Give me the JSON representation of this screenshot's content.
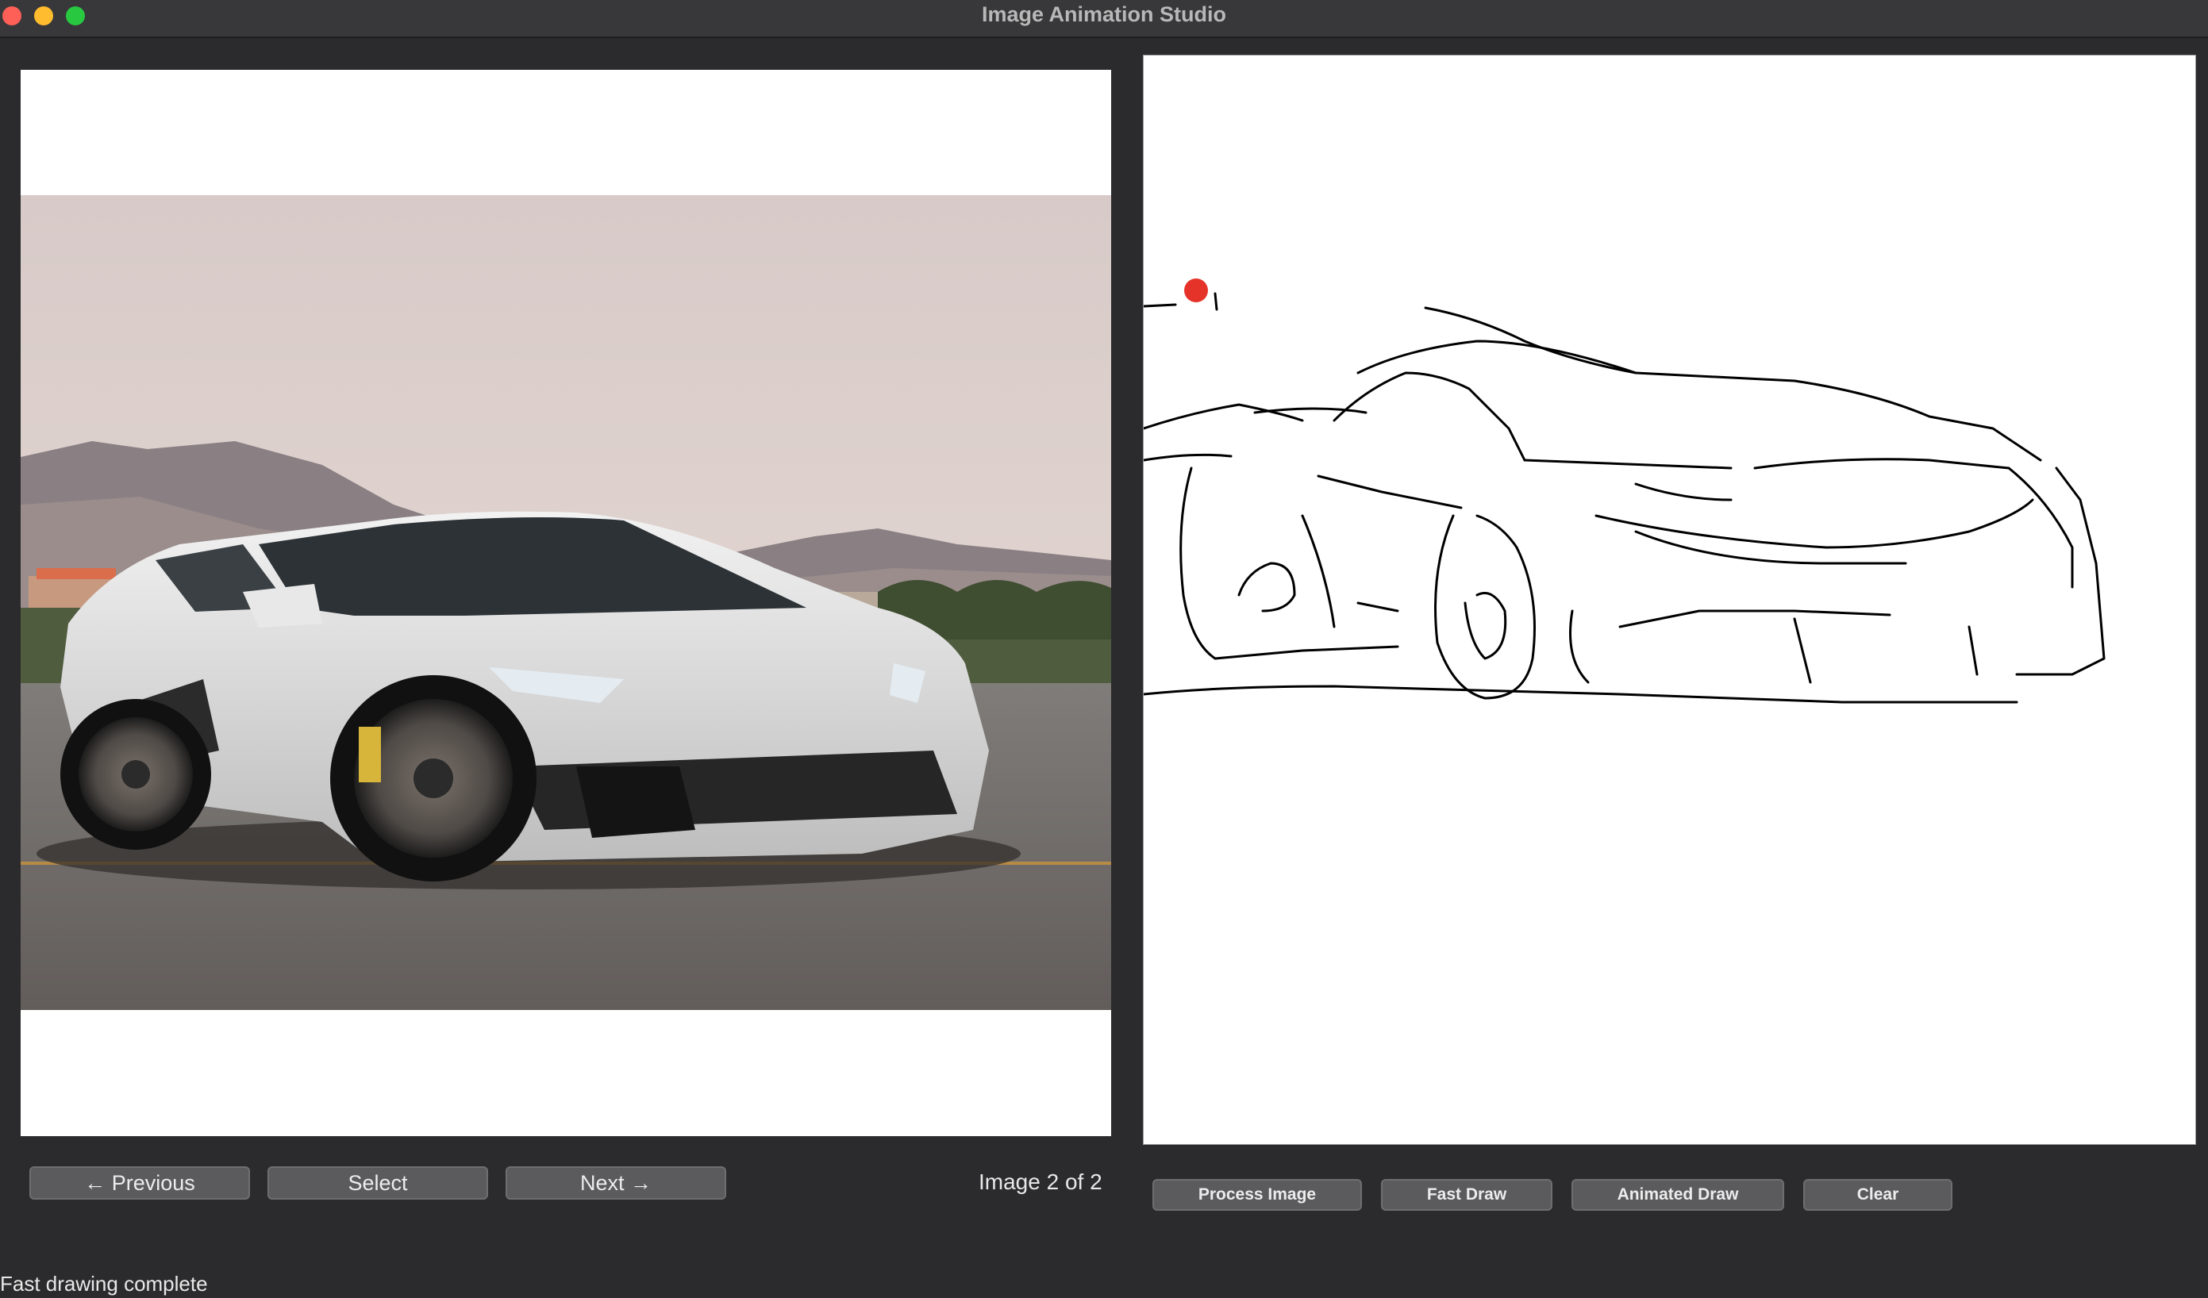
{
  "window": {
    "title": "Image Animation Studio"
  },
  "navigation": {
    "previous_label": "← Previous",
    "select_label": "Select",
    "next_label": "Next →",
    "page_info": "Image 2 of 2"
  },
  "actions": {
    "process_label": "Process Image",
    "fast_draw_label": "Fast Draw",
    "animated_draw_label": "Animated Draw",
    "clear_label": "Clear"
  },
  "status": {
    "text": "Fast drawing complete"
  },
  "colors": {
    "background": "#2b2b2d",
    "titlebar": "#38383a",
    "button": "#5b5b5e",
    "pen_marker": "#e5332a",
    "close": "#fe5f57",
    "minimize": "#febc2e",
    "maximize": "#28c840"
  }
}
